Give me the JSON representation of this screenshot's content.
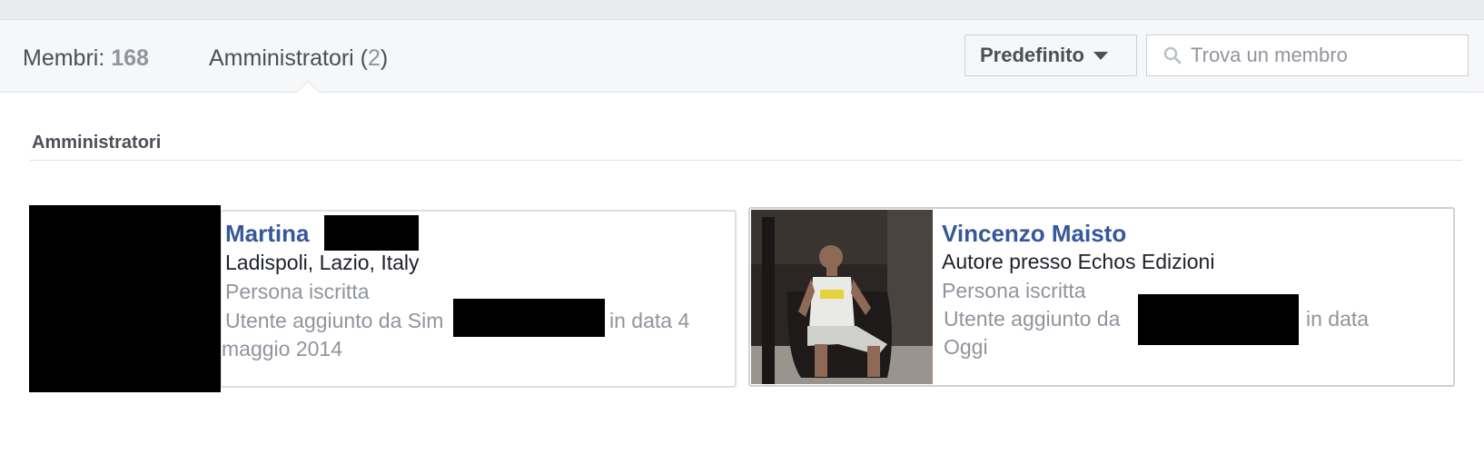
{
  "tabs": {
    "members_label": "Membri: ",
    "members_count": "168",
    "admins_label": "Amministratori (",
    "admins_count": "2",
    "admins_close": ")"
  },
  "toolbar": {
    "sort_label": "Predefinito",
    "search_placeholder": "Trova un membro"
  },
  "section": {
    "title": "Amministratori"
  },
  "admins": [
    {
      "first_name": "Martina",
      "location": "Ladispoli, Lazio, Italy",
      "status": "Persona iscritta",
      "added_prefix": "Utente aggiunto da Sim",
      "added_suffix": "in data 4",
      "added_date_line": "maggio 2014"
    },
    {
      "name": "Vincenzo Maisto",
      "work": "Autore presso Echos Edizioni",
      "status": "Persona iscritta",
      "added_prefix": "Utente aggiunto da",
      "added_suffix": "in data",
      "added_date_line": "Oggi"
    }
  ],
  "colors": {
    "link": "#365899",
    "muted": "#90949c",
    "text": "#1d2129",
    "redaction": "#000000"
  }
}
